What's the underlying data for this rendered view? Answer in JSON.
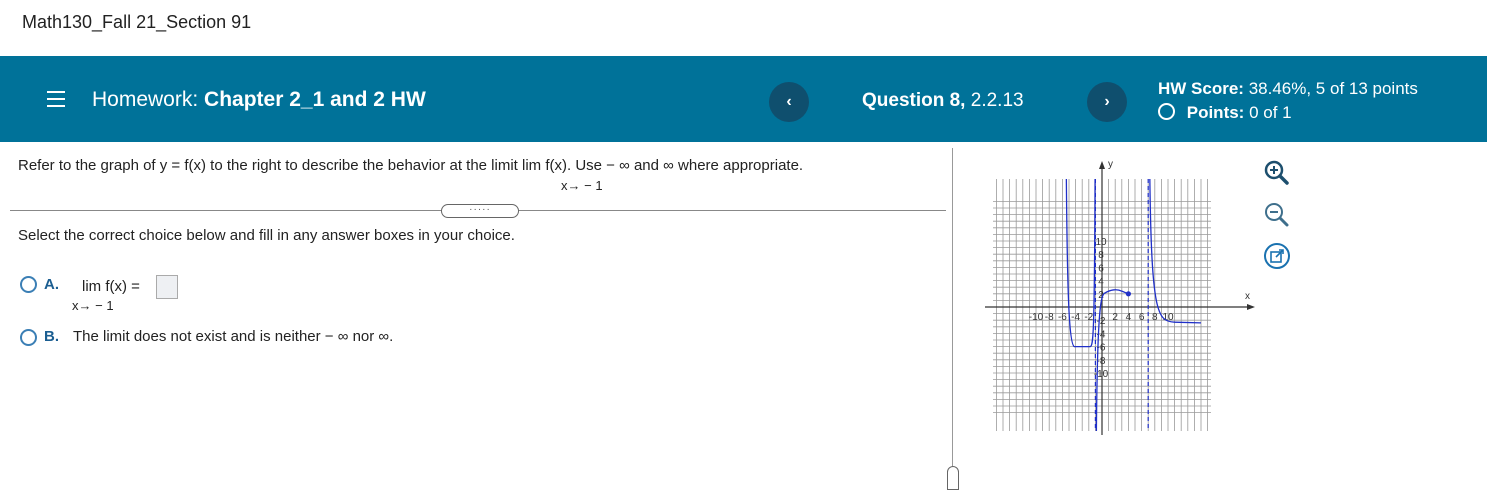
{
  "course": {
    "title": "Math130_Fall 21_Section 91"
  },
  "header": {
    "homework_prefix": "Homework:",
    "homework_name": "Chapter 2_1 and 2 HW",
    "question_prefix": "Question 8,",
    "question_number": "2.2.13",
    "prev_label": "‹",
    "next_label": "›",
    "score_label": "HW Score:",
    "score_value": "38.46%, 5 of 13 points",
    "points_label": "Points:",
    "points_value": "0 of 1"
  },
  "question": {
    "prompt": "Refer to the graph of y = f(x) to the right to describe the behavior at the limit   lim  f(x). Use  − ∞ and ∞ where appropriate.",
    "limit_sub": "x→ − 1",
    "expand_label": "·····",
    "instruction": "Select the correct choice below and fill in any answer boxes in your choice.",
    "choices": [
      {
        "letter": "A.",
        "text": "lim  f(x) =",
        "sub": "x→ − 1"
      },
      {
        "letter": "B.",
        "text": "The limit does not exist and is neither  − ∞ nor ∞."
      }
    ]
  },
  "graph": {
    "y_axis_label": "y",
    "x_axis_label": "x",
    "x_ticks": [
      "-10",
      "-8",
      "-6",
      "-4",
      "-2",
      "2",
      "4",
      "6",
      "8",
      "10"
    ],
    "y_ticks": [
      "10",
      "8",
      "6",
      "4",
      "2",
      "-2",
      "-4",
      "-6",
      "-8",
      "-10"
    ],
    "curve_color": "#1f2fc8",
    "asymptote_color": "#1f2fc8"
  },
  "tools": {
    "zoom_in": "zoom-in-icon",
    "zoom_out": "zoom-out-icon",
    "popout": "popout-icon"
  },
  "colors": {
    "header_bg": "#007299",
    "nav_btn": "#0f4f6e",
    "choice_letter": "#1b5e91"
  }
}
